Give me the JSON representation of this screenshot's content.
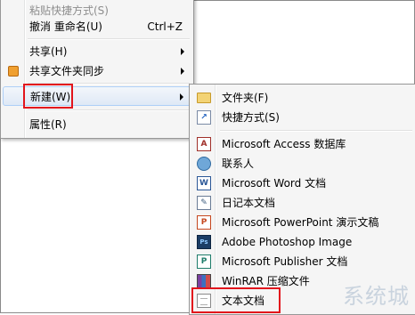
{
  "context_menu": {
    "items": [
      {
        "label": "粘贴快捷方式(S)",
        "shortcut": "",
        "disabled": true
      },
      {
        "label": "撤消 重命名(U)",
        "shortcut": "Ctrl+Z"
      },
      {
        "label": "共享(H)",
        "submenu": true
      },
      {
        "label": "共享文件夹同步",
        "submenu": true,
        "icon": "sync-icon"
      },
      {
        "label": "新建(W)",
        "submenu": true,
        "highlighted": true
      },
      {
        "label": "属性(R)"
      }
    ]
  },
  "new_submenu": {
    "items": [
      {
        "label": "文件夹(F)",
        "icon": "folder-icon"
      },
      {
        "label": "快捷方式(S)",
        "icon": "shortcut-icon"
      },
      {
        "label": "Microsoft Access 数据库",
        "icon": "access-icon"
      },
      {
        "label": "联系人",
        "icon": "contact-icon"
      },
      {
        "label": "Microsoft Word 文档",
        "icon": "word-icon"
      },
      {
        "label": "日记本文档",
        "icon": "journal-icon"
      },
      {
        "label": "Microsoft PowerPoint 演示文稿",
        "icon": "powerpoint-icon"
      },
      {
        "label": "Adobe Photoshop Image",
        "icon": "photoshop-icon"
      },
      {
        "label": "Microsoft Publisher 文档",
        "icon": "publisher-icon"
      },
      {
        "label": "WinRAR 压缩文件",
        "icon": "winrar-icon"
      },
      {
        "label": "文本文档",
        "icon": "text-document-icon",
        "highlighted": true
      }
    ]
  },
  "watermark": "系统城",
  "colors": {
    "highlight_border": "#e2141c",
    "menu_bg": "#f5f5f5"
  }
}
